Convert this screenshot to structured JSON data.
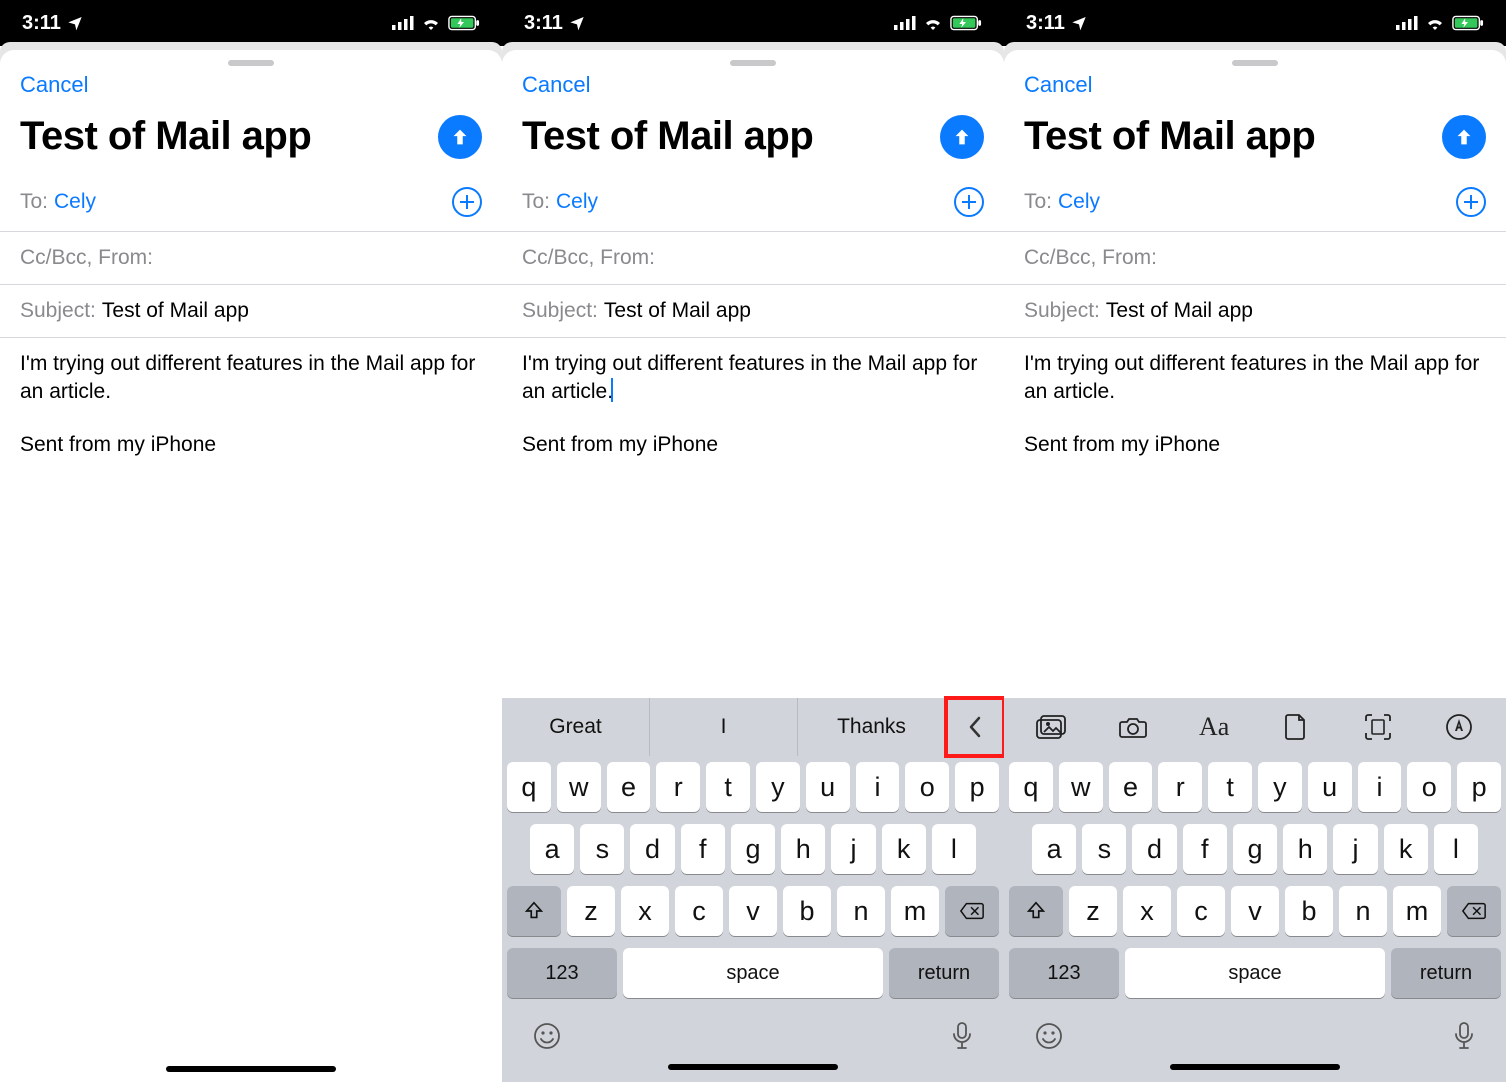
{
  "status": {
    "time": "3:11",
    "location_active": true
  },
  "compose": {
    "cancel": "Cancel",
    "title": "Test of Mail app",
    "to_label": "To:",
    "to_value": "Cely",
    "cc_label": "Cc/Bcc, From:",
    "subject_label": "Subject:",
    "subject_value": "Test of Mail app",
    "body_line1": "I'm trying out different features in the Mail app for an article.",
    "signature": "Sent from my iPhone"
  },
  "keyboard": {
    "suggestions": [
      "Great",
      "I",
      "Thanks"
    ],
    "tools": [
      "photo-library-icon",
      "camera-icon",
      "text-format-icon",
      "document-icon",
      "scan-icon",
      "markup-icon"
    ],
    "row1": [
      "q",
      "w",
      "e",
      "r",
      "t",
      "y",
      "u",
      "i",
      "o",
      "p"
    ],
    "row2": [
      "a",
      "s",
      "d",
      "f",
      "g",
      "h",
      "j",
      "k",
      "l"
    ],
    "row3": [
      "z",
      "x",
      "c",
      "v",
      "b",
      "n",
      "m"
    ],
    "num_key": "123",
    "space_key": "space",
    "return_key": "return"
  }
}
